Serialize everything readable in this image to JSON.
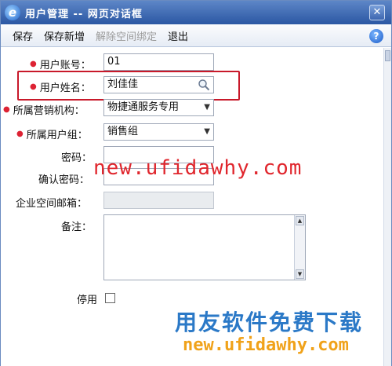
{
  "window": {
    "title": "用户管理 -- 网页对话框"
  },
  "toolbar": {
    "save": "保存",
    "save_new": "保存新增",
    "unbind": "解除空间绑定",
    "exit": "退出",
    "help": "?"
  },
  "form": {
    "account_label": "用户账号：",
    "account_value": "01",
    "name_label": "用户姓名：",
    "name_value": "刘佳佳",
    "org_label": "所属营销机构：",
    "org_value": "物捷通服务专用",
    "group_label": "所属用户组：",
    "group_value": "销售组",
    "password_label": "密码：",
    "confirm_label": "确认密码：",
    "email_label": "企业空间邮箱：",
    "remark_label": "备注：",
    "disable_label": "停用"
  },
  "watermark": {
    "url_red": "new.ufidawhy.com",
    "brand": "用友软件免费下载",
    "url_orange": "new.ufidawhy.com"
  }
}
